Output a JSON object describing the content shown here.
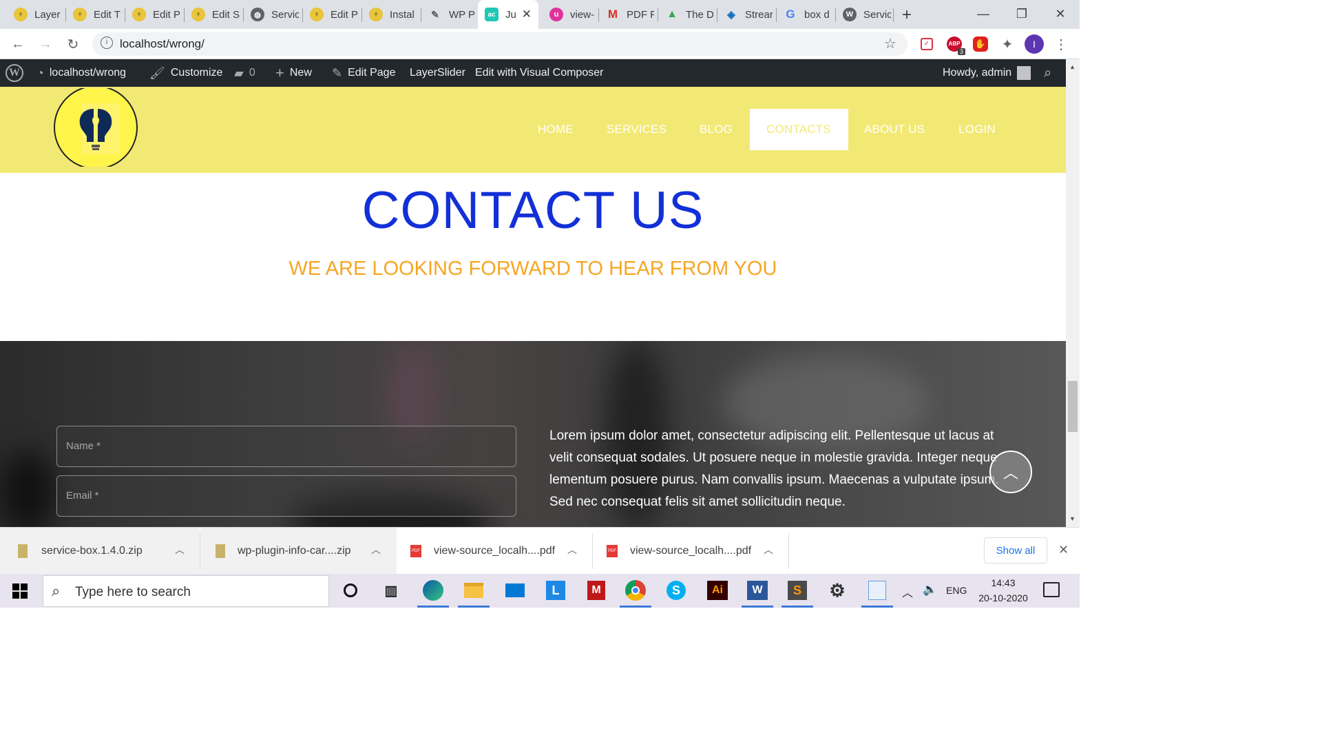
{
  "browser": {
    "tabs": [
      {
        "label": "Layer",
        "icon": "bulb-icon"
      },
      {
        "label": "Edit T",
        "icon": "bulb-icon"
      },
      {
        "label": "Edit P",
        "icon": "bulb-icon"
      },
      {
        "label": "Edit S",
        "icon": "bulb-icon"
      },
      {
        "label": "Servic",
        "icon": "globe-icon"
      },
      {
        "label": "Edit P",
        "icon": "bulb-icon"
      },
      {
        "label": "Instal",
        "icon": "bulb-icon"
      },
      {
        "label": "WP P",
        "icon": "wp-plugin-icon"
      },
      {
        "label": "Ju",
        "icon": "ac-icon",
        "active": true
      },
      {
        "label": "view-",
        "icon": "u-icon"
      },
      {
        "label": "PDF F",
        "icon": "gmail-icon"
      },
      {
        "label": "The D",
        "icon": "drive-icon"
      },
      {
        "label": "Strear",
        "icon": "stream-icon"
      },
      {
        "label": "box d",
        "icon": "google-icon"
      },
      {
        "label": "Servic",
        "icon": "wordpress-icon"
      }
    ],
    "url": "localhost/wrong/",
    "profile_initial": "I",
    "abp_count": "3"
  },
  "admin_bar": {
    "site": "localhost/wrong",
    "customize": "Customize",
    "comments": "0",
    "new": "New",
    "edit_page": "Edit Page",
    "layerslider": "LayerSlider",
    "visual_composer": "Edit with Visual Composer",
    "howdy": "Howdy, admin"
  },
  "nav": {
    "items": [
      "HOME",
      "SERVICES",
      "BLOG",
      "CONTACTS",
      "ABOUT US",
      "LOGIN"
    ],
    "active": "CONTACTS"
  },
  "hero": {
    "title": "CONTACT US",
    "subtitle": "WE ARE LOOKING FORWARD TO HEAR FROM YOU"
  },
  "form": {
    "name_placeholder": "Name *",
    "email_placeholder": "Email *"
  },
  "contact_text": "Lorem ipsum dolor amet, consectetur adipiscing elit. Pellentesque ut lacus at velit consequat sodales. Ut posuere neque in molestie gravida. Integer neque lementum posuere purus. Nam convallis ipsum. Maecenas a vulputate ipsum. Sed nec consequat felis sit amet sollicitudin neque.",
  "downloads": {
    "items": [
      {
        "name": "service-box.1.4.0.zip",
        "type": "zip"
      },
      {
        "name": "wp-plugin-info-car....zip",
        "type": "zip"
      },
      {
        "name": "view-source_localh....pdf",
        "type": "pdf"
      },
      {
        "name": "view-source_localh....pdf",
        "type": "pdf"
      }
    ],
    "show_all": "Show all"
  },
  "taskbar": {
    "search_placeholder": "Type here to search",
    "language": "ENG",
    "time": "14:43",
    "date": "20-10-2020"
  },
  "colors": {
    "header_bg": "#f2e975",
    "title": "#1230d8",
    "subtitle": "#f6a623",
    "admin_bar": "#23282d"
  }
}
